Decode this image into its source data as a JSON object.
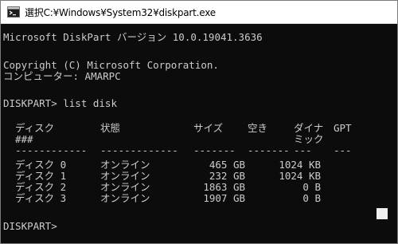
{
  "window": {
    "title": "選択C:¥Windows¥System32¥diskpart.exe"
  },
  "console": {
    "version_line": "Microsoft DiskPart バージョン 10.0.19041.3636",
    "copyright_line": "Copyright (C) Microsoft Corporation.",
    "computer_line": "コンピューター: AMARPC",
    "prompt_line": "DISKPART> list disk",
    "final_prompt": "DISKPART>",
    "headers": {
      "disk": "ディスク",
      "disk_sub": "###",
      "status": "状態",
      "size": "サイズ",
      "free": "空き",
      "dyn": "ダイナ",
      "dyn_sub": "ミック",
      "gpt": "GPT"
    },
    "separators": {
      "disk": "------------",
      "status": "-------------",
      "size": "-------",
      "free": "-------",
      "dyn": "---",
      "gpt": "---"
    },
    "disks": [
      {
        "name": "ディスク 0",
        "status": "オンライン",
        "size": "465 GB",
        "free": "1024 KB"
      },
      {
        "name": "ディスク 1",
        "status": "オンライン",
        "size": "232 GB",
        "free": "1024 KB"
      },
      {
        "name": "ディスク 2",
        "status": "オンライン",
        "size": "1863 GB",
        "free": "0 B"
      },
      {
        "name": "ディスク 3",
        "status": "オンライン",
        "size": "1907 GB",
        "free": "0 B"
      }
    ]
  },
  "icons": {
    "app": "cmd-icon"
  },
  "colors": {
    "background": "#0c0c0c",
    "text": "#cccccc",
    "titlebar": "#ffffff"
  }
}
